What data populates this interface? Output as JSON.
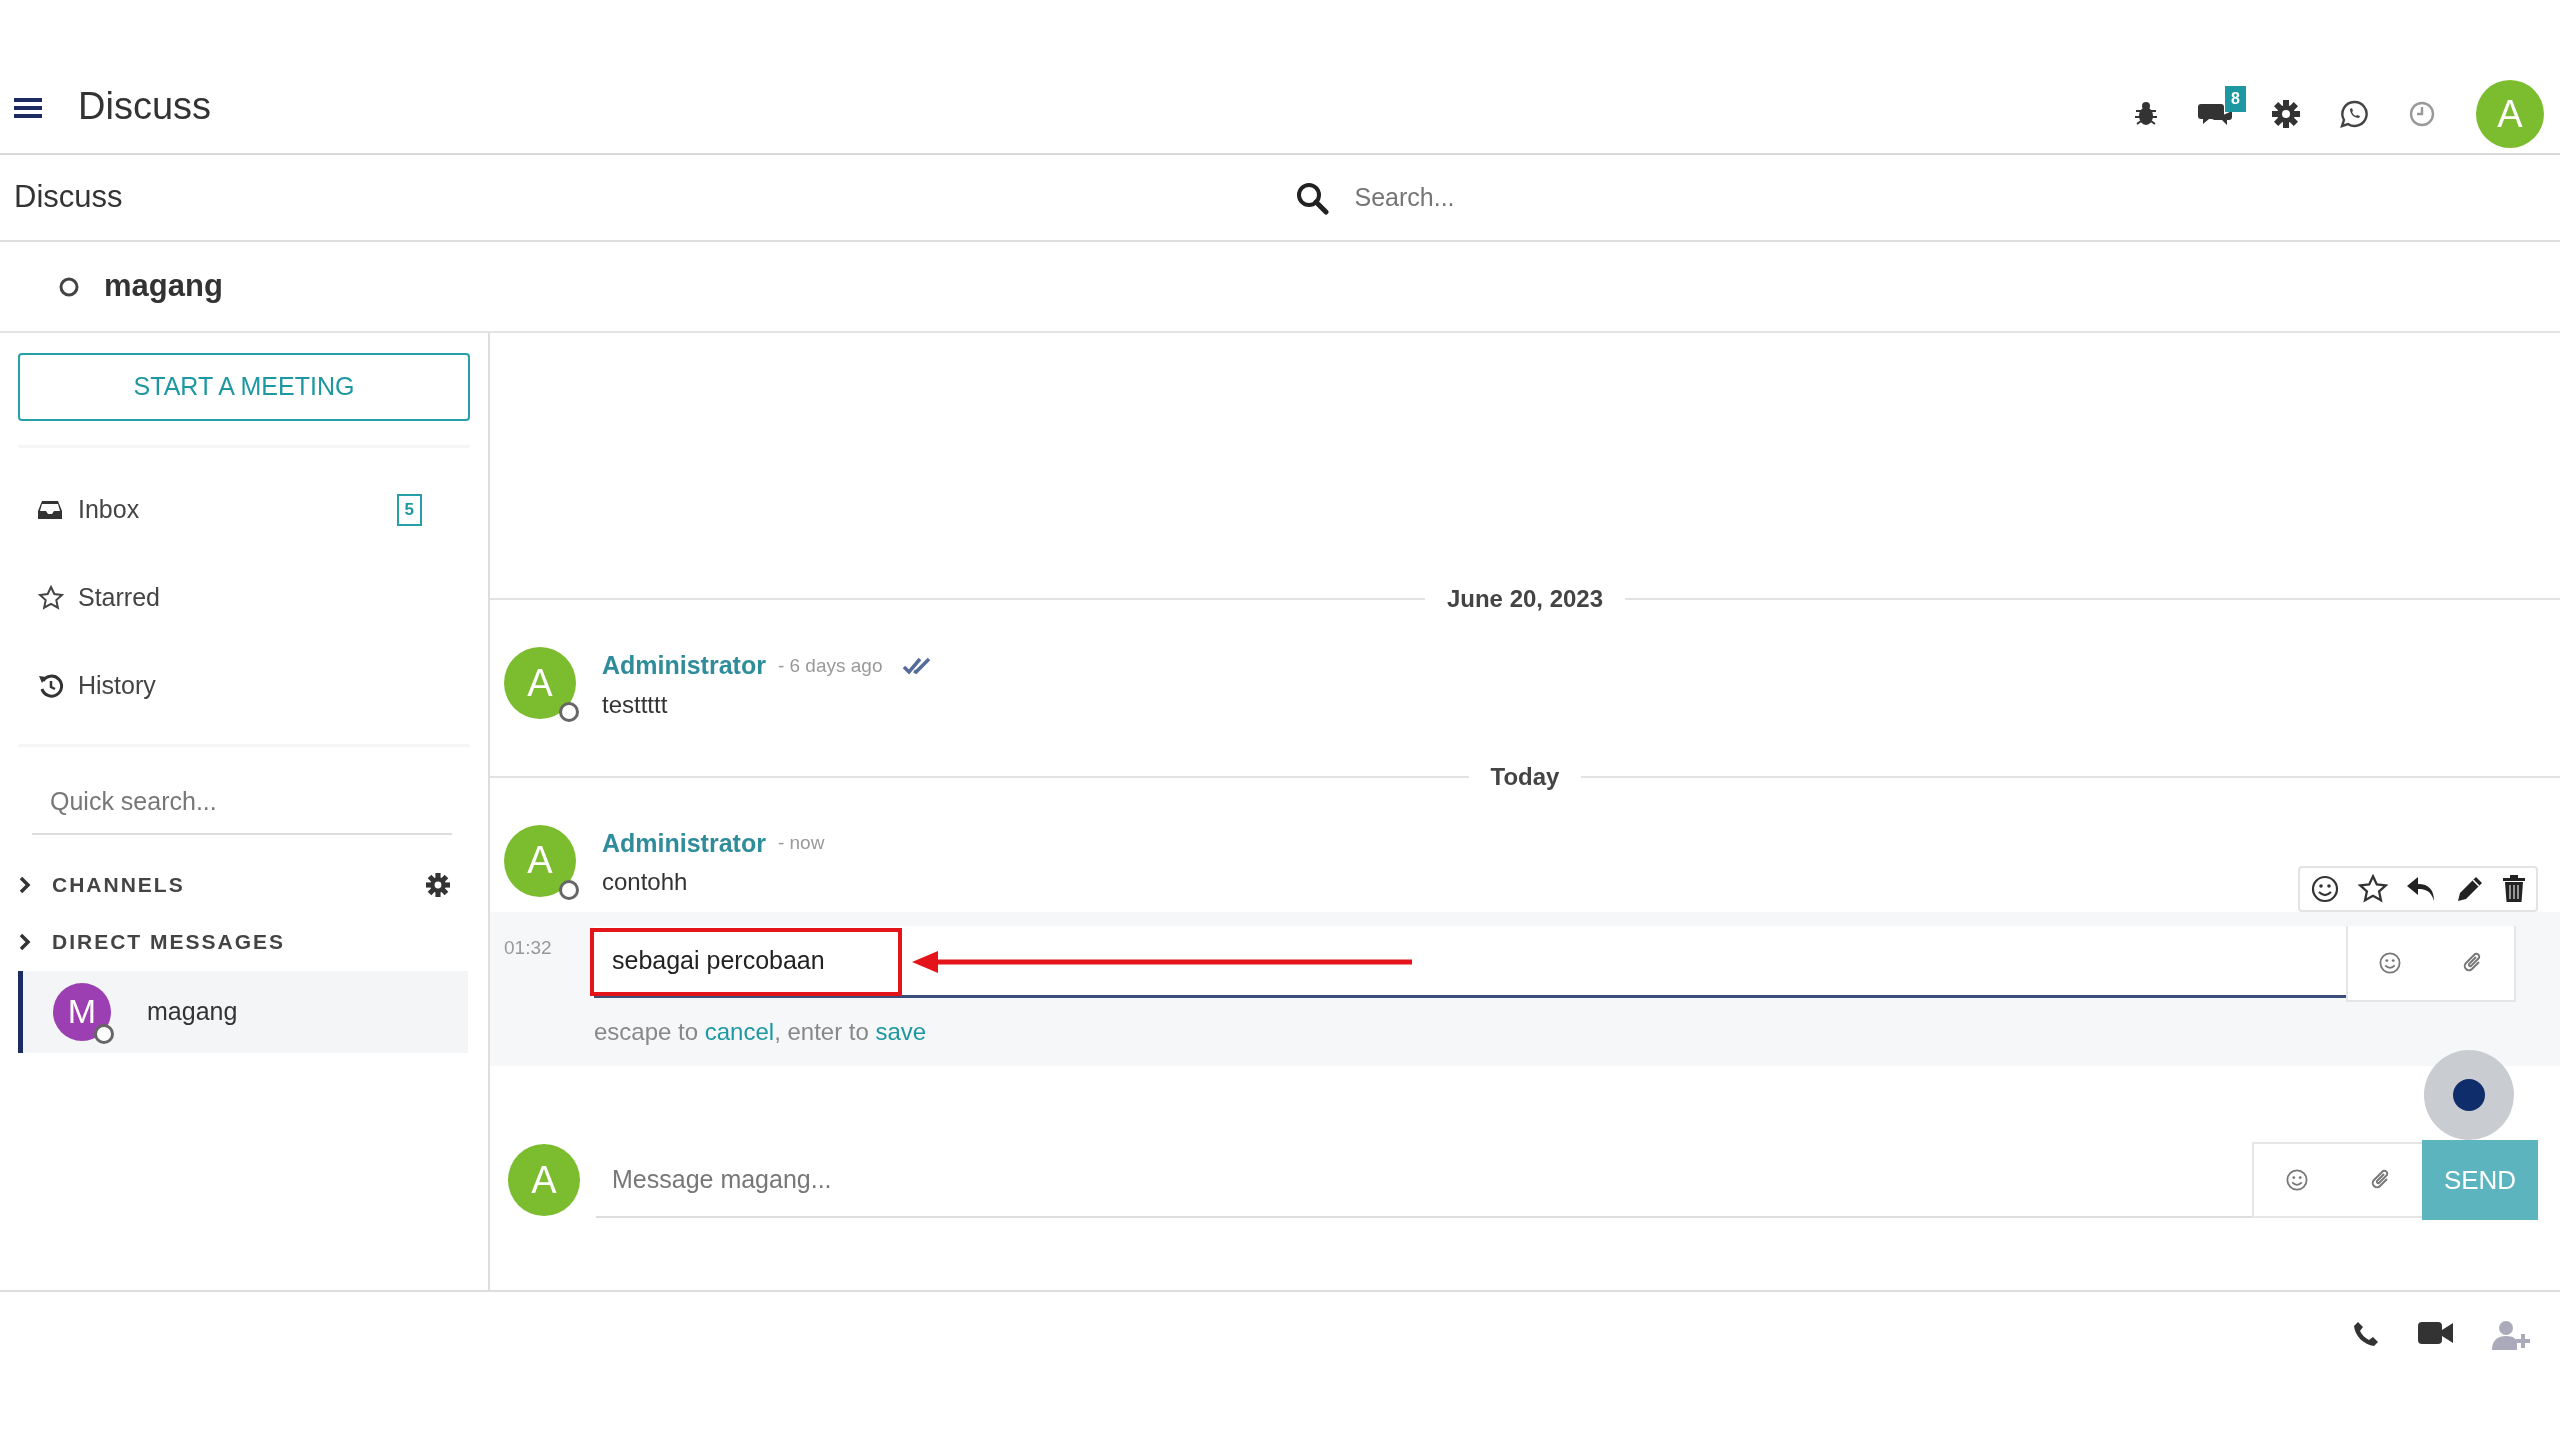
{
  "navbar": {
    "title": "Discuss",
    "messaging_counter": "8",
    "avatar_letter": "A"
  },
  "control_panel": {
    "breadcrumb": "Discuss",
    "search": {
      "placeholder": "Search..."
    }
  },
  "thread_header": {
    "name": "magang"
  },
  "sidebar": {
    "meeting_button": "START A MEETING",
    "mailboxes": [
      {
        "kind": "inbox",
        "label": "Inbox",
        "counter": "5"
      },
      {
        "kind": "starred",
        "label": "Starred"
      },
      {
        "kind": "history",
        "label": "History"
      }
    ],
    "quick_search": {
      "placeholder": "Quick search..."
    },
    "categories": [
      {
        "label": "CHANNELS",
        "expanded": false,
        "has_settings": true
      },
      {
        "label": "DIRECT MESSAGES",
        "expanded": false,
        "has_settings": false
      }
    ],
    "chats": [
      {
        "avatar_letter": "M",
        "color": "#9c3fb3",
        "name": "magang",
        "selected": true
      }
    ]
  },
  "days": [
    {
      "date": "June 20, 2023",
      "messages": [
        {
          "avatar_letter": "A",
          "author": "Administrator",
          "time": "- 6 days ago",
          "seen": true,
          "body": "testtttt"
        }
      ]
    },
    {
      "date": "Today",
      "messages": [
        {
          "avatar_letter": "A",
          "author": "Administrator",
          "time": "- now",
          "seen": false,
          "body": "contohh",
          "edit": {
            "time": "01:32",
            "value": "sebagai percobaan",
            "hint_start": "escape to",
            "cancel_link": "cancel",
            "hint_middle": ", enter to",
            "save_link": "save"
          }
        }
      ]
    }
  ],
  "composer": {
    "avatar_letter": "A",
    "placeholder": "Message magang...",
    "send": "SEND"
  }
}
